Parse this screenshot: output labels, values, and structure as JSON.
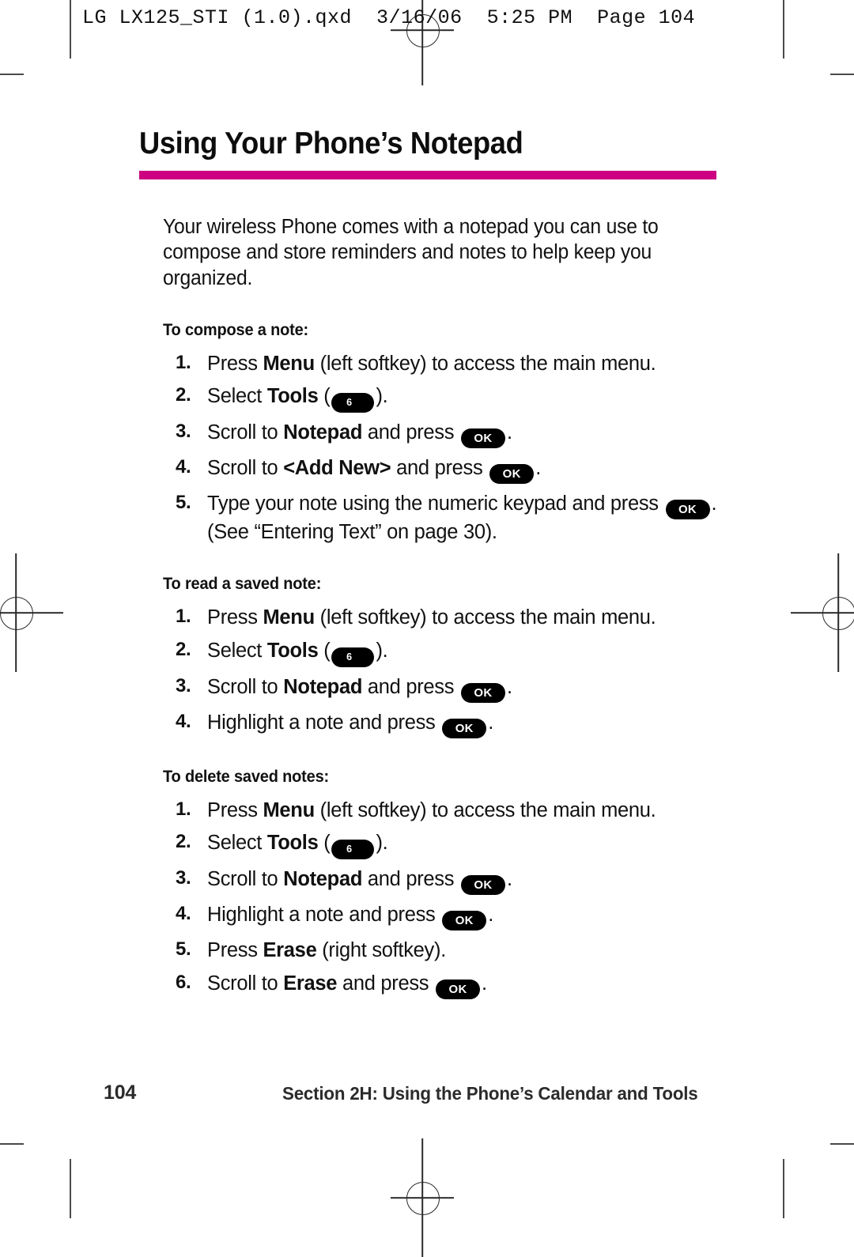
{
  "print_header": {
    "text": "LG LX125_STI (1.0).qxd  3/16/06  5:25 PM  Page 104"
  },
  "title": "Using Your Phone’s Notepad",
  "accent_color": "#cc0081",
  "intro": "Your wireless Phone comes with a notepad you can use to compose and store reminders and notes to help keep you organized.",
  "sections": [
    {
      "heading": "To compose a note:",
      "steps": [
        {
          "num": "1.",
          "parts": [
            {
              "t": "text",
              "v": "Press "
            },
            {
              "t": "bold",
              "v": "Menu"
            },
            {
              "t": "text",
              "v": " (left softkey) to access the main menu."
            }
          ]
        },
        {
          "num": "2.",
          "parts": [
            {
              "t": "text",
              "v": "Select "
            },
            {
              "t": "bold",
              "v": "Tools"
            },
            {
              "t": "text",
              "v": " ("
            },
            {
              "t": "key",
              "v": "6",
              "style": "num6"
            },
            {
              "t": "text",
              "v": ")."
            }
          ]
        },
        {
          "num": "3.",
          "parts": [
            {
              "t": "text",
              "v": "Scroll to "
            },
            {
              "t": "bold",
              "v": "Notepad"
            },
            {
              "t": "text",
              "v": " and press "
            },
            {
              "t": "key",
              "v": "OK",
              "style": "ok"
            },
            {
              "t": "text",
              "v": "."
            }
          ]
        },
        {
          "num": "4.",
          "parts": [
            {
              "t": "text",
              "v": "Scroll to "
            },
            {
              "t": "bold",
              "v": "<Add New>"
            },
            {
              "t": "text",
              "v": " and press "
            },
            {
              "t": "key",
              "v": "OK",
              "style": "ok"
            },
            {
              "t": "text",
              "v": "."
            }
          ]
        },
        {
          "num": "5.",
          "parts": [
            {
              "t": "text",
              "v": "Type your note using the numeric keypad and press "
            },
            {
              "t": "key",
              "v": "OK",
              "style": "ok"
            },
            {
              "t": "text",
              "v": ". (See “Entering Text” on page 30)."
            }
          ]
        }
      ]
    },
    {
      "heading": "To read a saved note:",
      "steps": [
        {
          "num": "1.",
          "parts": [
            {
              "t": "text",
              "v": "Press "
            },
            {
              "t": "bold",
              "v": "Menu"
            },
            {
              "t": "text",
              "v": " (left softkey) to access the main menu."
            }
          ]
        },
        {
          "num": "2.",
          "parts": [
            {
              "t": "text",
              "v": "Select "
            },
            {
              "t": "bold",
              "v": "Tools"
            },
            {
              "t": "text",
              "v": " ("
            },
            {
              "t": "key",
              "v": "6",
              "style": "num6"
            },
            {
              "t": "text",
              "v": ")."
            }
          ]
        },
        {
          "num": "3.",
          "parts": [
            {
              "t": "text",
              "v": "Scroll to "
            },
            {
              "t": "bold",
              "v": "Notepad"
            },
            {
              "t": "text",
              "v": " and press "
            },
            {
              "t": "key",
              "v": "OK",
              "style": "ok"
            },
            {
              "t": "text",
              "v": "."
            }
          ]
        },
        {
          "num": "4.",
          "parts": [
            {
              "t": "text",
              "v": "Highlight a note and press "
            },
            {
              "t": "key",
              "v": "OK",
              "style": "ok"
            },
            {
              "t": "text",
              "v": "."
            }
          ]
        }
      ]
    },
    {
      "heading": "To delete saved notes:",
      "steps": [
        {
          "num": "1.",
          "parts": [
            {
              "t": "text",
              "v": "Press "
            },
            {
              "t": "bold",
              "v": "Menu"
            },
            {
              "t": "text",
              "v": " (left softkey) to access the main menu."
            }
          ]
        },
        {
          "num": "2.",
          "parts": [
            {
              "t": "text",
              "v": "Select "
            },
            {
              "t": "bold",
              "v": "Tools"
            },
            {
              "t": "text",
              "v": " ("
            },
            {
              "t": "key",
              "v": "6",
              "style": "num6"
            },
            {
              "t": "text",
              "v": ")."
            }
          ]
        },
        {
          "num": "3.",
          "parts": [
            {
              "t": "text",
              "v": "Scroll to "
            },
            {
              "t": "bold",
              "v": "Notepad"
            },
            {
              "t": "text",
              "v": " and press "
            },
            {
              "t": "key",
              "v": "OK",
              "style": "ok"
            },
            {
              "t": "text",
              "v": "."
            }
          ]
        },
        {
          "num": "4.",
          "parts": [
            {
              "t": "text",
              "v": "Highlight a note and press "
            },
            {
              "t": "key",
              "v": "OK",
              "style": "ok"
            },
            {
              "t": "text",
              "v": "."
            }
          ]
        },
        {
          "num": "5.",
          "parts": [
            {
              "t": "text",
              "v": "Press "
            },
            {
              "t": "bold",
              "v": "Erase"
            },
            {
              "t": "text",
              "v": " (right softkey)."
            }
          ]
        },
        {
          "num": "6.",
          "parts": [
            {
              "t": "text",
              "v": "Scroll to "
            },
            {
              "t": "bold",
              "v": "Erase"
            },
            {
              "t": "text",
              "v": " and press "
            },
            {
              "t": "key",
              "v": "OK",
              "style": "ok"
            },
            {
              "t": "text",
              "v": "."
            }
          ]
        }
      ]
    }
  ],
  "footer": {
    "page_number": "104",
    "running_foot": "Section 2H: Using the Phone’s Calendar and Tools"
  }
}
